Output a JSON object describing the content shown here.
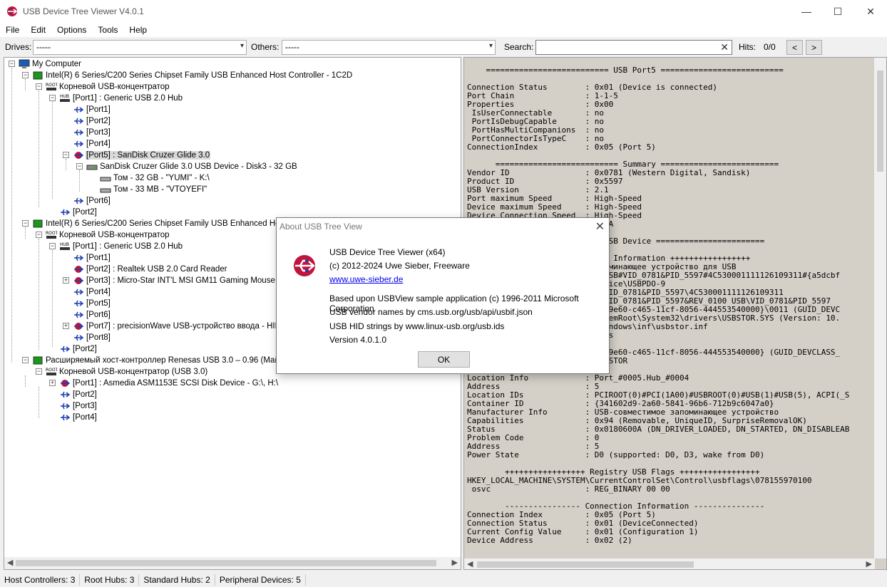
{
  "window": {
    "title": "USB Device Tree Viewer V4.0.1",
    "minimize": "—",
    "maximize": "☐",
    "close": "✕"
  },
  "menu": [
    "File",
    "Edit",
    "Options",
    "Tools",
    "Help"
  ],
  "toolbar": {
    "drives_label": "Drives:",
    "drives_value": "-----",
    "others_label": "Others:",
    "others_value": "-----",
    "search_label": "Search:",
    "search_value": "",
    "hits_label": "Hits:",
    "hits_value": "0/0",
    "prev": "<",
    "next": ">"
  },
  "tree": [
    "My Computer",
    "Intel(R) 6 Series/C200 Series Chipset Family USB Enhanced Host Controller - 1C2D",
    "Корневой USB-концентратор",
    "[Port1] : Generic USB 2.0 Hub",
    "[Port1]",
    "[Port2]",
    "[Port3]",
    "[Port4]",
    "[Port5] : SanDisk Cruzer Glide 3.0",
    "SanDisk Cruzer Glide 3.0 USB Device - Disk3 - 32 GB",
    "Том - 32 GB - \"YUMI\" - K:\\",
    "Том - 33 MB - \"VTOYEFI\"",
    "[Port6]",
    "[Port2]",
    "Intel(R) 6 Series/C200 Series Chipset Family USB Enhanced Host Co",
    "Корневой USB-концентратор",
    "[Port1] : Generic USB 2.0 Hub",
    "[Port1]",
    "[Port2] : Realtek USB 2.0 Card Reader",
    "[Port3] : Micro-Star INT'L MSI GM11 Gaming Mouse - Mo",
    "[Port4]",
    "[Port5]",
    "[Port6]",
    "[Port7] : precisionWave USB-устройство ввода - HID-c",
    "[Port8]",
    "[Port2]",
    "Расширяемый хост-контроллер Renesas USB 3.0 – 0.96 (Майкро",
    "Корневой USB-концентратор (USB 3.0)",
    "[Port1] : Asmedia ASM1153E SCSI Disk Device - G:\\, H:\\",
    "[Port2]",
    "[Port3]",
    "[Port4]"
  ],
  "detail_text": "    ========================== USB Port5 ==========================\n\nConnection Status        : 0x01 (Device is connected)\nPort Chain               : 1-1-5\nProperties               : 0x00\n IsUserConnectable       : no\n PortIsDebugCapable      : no\n PortHasMultiCompanions  : no\n PortConnectorIsTypeC    : no\nConnectionIndex          : 0x05 (Port 5)\n\n      ========================== Summary =========================\nVendor ID                : 0x0781 (Western Digital, Sandisk)\nProduct ID               : 0x5597\nUSB Version              : 2.1\nPort maximum Speed       : High-Speed\nDevice maximum Speed     : High-Speed\nDevice Connection Speed  : High-Speed\n                           4 mA\n\n                           = USB Device =======================\n\n                           ice Information +++++++++++++++++\n                           апоминающее устройство для USB\n                           ?\\USB#VID_0781&PID_5597#4C530001111126109311#{a5dcbf\n                           Device\\USBPDO-9\n                           B\\VID_0781&PID_5597\\4C530001111126109311\n                           B\\VID_0781&PID_5597&REV_0100 USB\\VID_0781&PID_5597\n                           6fc9e60-c465-11cf-8056-444553540000}\\0011 (GUID_DEVC\n                           ystemRoot\\System32\\drivers\\USBSTOR.SYS (Version: 10.\n                           \\Windows\\inf\\usbstor.inf\n                           PBus\n                           B\n                           6fc9e60-c465-11cf-8056-444553540000} (GUID_DEVCLASS_\nService                  : USBSTOR\nEnumerator               : USB\nLocation Info            : Port_#0005.Hub_#0004\nAddress                  : 5\nLocation IDs             : PCIROOT(0)#PCI(1A00)#USBROOT(0)#USB(1)#USB(5), ACPI(_S\nContainer ID             : {341602d9-2a60-5841-96b6-712b9c6047a0}\nManufacturer Info        : USB-совместимое запоминающее устройство\nCapabilities             : 0x94 (Removable, UniqueID, SurpriseRemovalOK)\nStatus                   : 0x0180600A (DN_DRIVER_LOADED, DN_STARTED, DN_DISABLEAB\nProblem Code             : 0\nAddress                  : 5\nPower State              : D0 (supported: D0, D3, wake from D0)\n\n        +++++++++++++++++ Registry USB Flags +++++++++++++++++\nHKEY_LOCAL_MACHINE\\SYSTEM\\CurrentControlSet\\Control\\usbflags\\078155970100\n osvc                    : REG_BINARY 00 00\n\n        ---------------- Connection Information ---------------\nConnection Index         : 0x05 (Port 5)\nConnection Status        : 0x01 (DeviceConnected)\nCurrent Config Value     : 0x01 (Configuration 1)\nDevice Address           : 0x02 (2)",
  "status": [
    "Host Controllers: 3",
    "Root Hubs: 3",
    "Standard Hubs: 2",
    "Peripheral Devices: 5"
  ],
  "about": {
    "title": "About USB Tree View",
    "close": "✕",
    "line1": "USB Device Tree Viewer (x64)",
    "line2": "(c) 2012-2024 Uwe Sieber, Freeware",
    "link": "www.uwe-sieber.de",
    "line4": "Based upon USBView sample application (c) 1996-2011 Microsoft Corporation",
    "line5": "USB vendor names by cms.usb.org/usb/api/usbif.json",
    "line6": "USB HID strings by www.linux-usb.org/usb.ids",
    "line7": "Version 4.0.1.0",
    "ok": "OK"
  },
  "colors": {
    "detail_bg": "#d4d0c8",
    "selection": "#d9d9d9",
    "link": "#0000ee"
  }
}
